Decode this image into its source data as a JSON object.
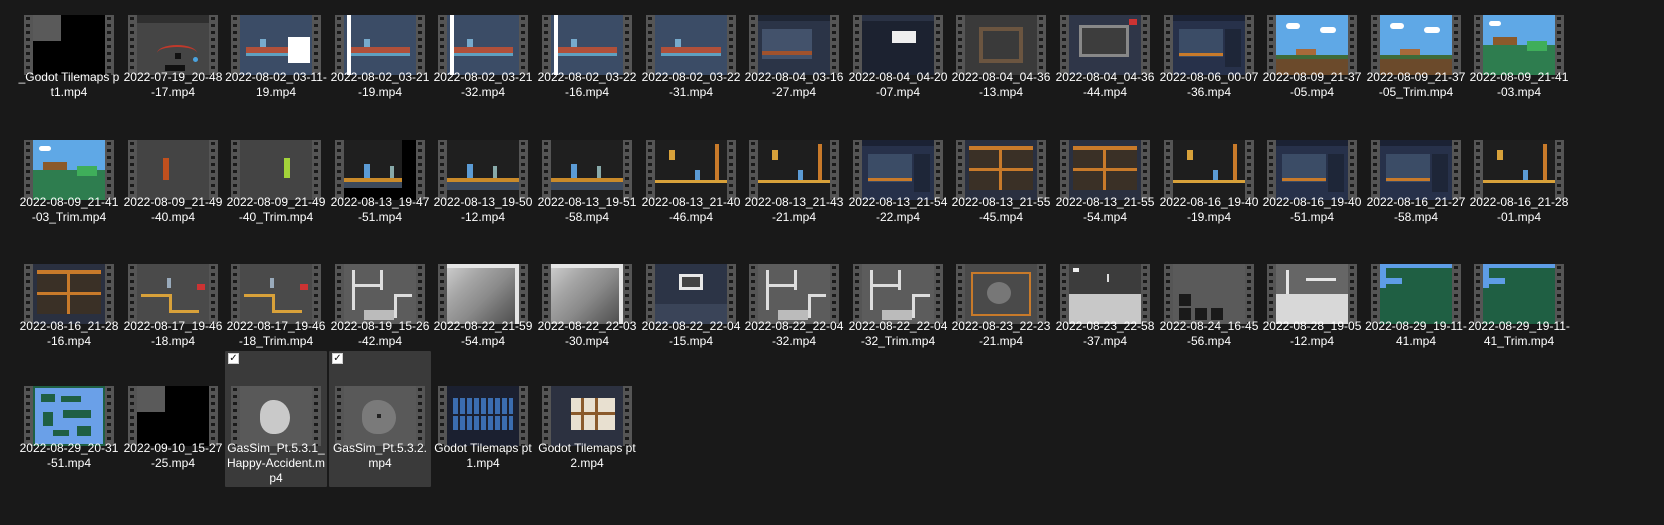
{
  "files": [
    {
      "row": 0,
      "col": 0,
      "name": "_Godot Tilemaps pt1.mp4",
      "thumb": "black-grey"
    },
    {
      "row": 0,
      "col": 1,
      "name": "2022-07-19_20-48-17.mp4",
      "thumb": "editor-red"
    },
    {
      "row": 0,
      "col": 2,
      "name": "2022-08-02_03-11-19.mp4",
      "thumb": "game-white"
    },
    {
      "row": 0,
      "col": 3,
      "name": "2022-08-02_03-21-19.mp4",
      "thumb": "game-bar"
    },
    {
      "row": 0,
      "col": 4,
      "name": "2022-08-02_03-21-32.mp4",
      "thumb": "game-bar"
    },
    {
      "row": 0,
      "col": 5,
      "name": "2022-08-02_03-22-16.mp4",
      "thumb": "game-bar"
    },
    {
      "row": 0,
      "col": 6,
      "name": "2022-08-02_03-22-31.mp4",
      "thumb": "game"
    },
    {
      "row": 0,
      "col": 7,
      "name": "2022-08-04_03-16-27.mp4",
      "thumb": "editor"
    },
    {
      "row": 0,
      "col": 8,
      "name": "2022-08-04_04-20-07.mp4",
      "thumb": "editor-dark"
    },
    {
      "row": 0,
      "col": 9,
      "name": "2022-08-04_04-36-13.mp4",
      "thumb": "room"
    },
    {
      "row": 0,
      "col": 10,
      "name": "2022-08-04_04-36-44.mp4",
      "thumb": "room-editor"
    },
    {
      "row": 0,
      "col": 11,
      "name": "2022-08-06_00-07-36.mp4",
      "thumb": "editor-blue"
    },
    {
      "row": 0,
      "col": 12,
      "name": "2022-08-09_21-37-05.mp4",
      "thumb": "sky"
    },
    {
      "row": 0,
      "col": 13,
      "name": "2022-08-09_21-37-05_Trim.mp4",
      "thumb": "sky"
    },
    {
      "row": 0,
      "col": 14,
      "name": "2022-08-09_21-41-03.mp4",
      "thumb": "sky-green"
    },
    {
      "row": 1,
      "col": 0,
      "name": "2022-08-09_21-41-03_Trim.mp4",
      "thumb": "sky-green"
    },
    {
      "row": 1,
      "col": 1,
      "name": "2022-08-09_21-49-40.mp4",
      "thumb": "grey-red"
    },
    {
      "row": 1,
      "col": 2,
      "name": "2022-08-09_21-49-40_Trim.mp4",
      "thumb": "grey-lime"
    },
    {
      "row": 1,
      "col": 3,
      "name": "2022-08-13_19-47-51.mp4",
      "thumb": "platform-black"
    },
    {
      "row": 1,
      "col": 4,
      "name": "2022-08-13_19-50-12.mp4",
      "thumb": "platform"
    },
    {
      "row": 1,
      "col": 5,
      "name": "2022-08-13_19-51-58.mp4",
      "thumb": "platform"
    },
    {
      "row": 1,
      "col": 6,
      "name": "2022-08-13_21-40-46.mp4",
      "thumb": "platform-orange"
    },
    {
      "row": 1,
      "col": 7,
      "name": "2022-08-13_21-43-21.mp4",
      "thumb": "platform-orange"
    },
    {
      "row": 1,
      "col": 8,
      "name": "2022-08-13_21-54-22.mp4",
      "thumb": "editor-blue"
    },
    {
      "row": 1,
      "col": 9,
      "name": "2022-08-13_21-55-45.mp4",
      "thumb": "rooms-orange"
    },
    {
      "row": 1,
      "col": 10,
      "name": "2022-08-13_21-55-54.mp4",
      "thumb": "rooms-orange"
    },
    {
      "row": 1,
      "col": 11,
      "name": "2022-08-16_19-40-19.mp4",
      "thumb": "platform-orange"
    },
    {
      "row": 1,
      "col": 12,
      "name": "2022-08-16_19-40-51.mp4",
      "thumb": "editor-blue"
    },
    {
      "row": 1,
      "col": 13,
      "name": "2022-08-16_21-27-58.mp4",
      "thumb": "editor-blue"
    },
    {
      "row": 1,
      "col": 14,
      "name": "2022-08-16_21-28-01.mp4",
      "thumb": "platform-orange"
    },
    {
      "row": 2,
      "col": 0,
      "name": "2022-08-16_21-28-16.mp4",
      "thumb": "rooms-orange"
    },
    {
      "row": 2,
      "col": 1,
      "name": "2022-08-17_19-46-18.mp4",
      "thumb": "pipes"
    },
    {
      "row": 2,
      "col": 2,
      "name": "2022-08-17_19-46-18_Trim.mp4",
      "thumb": "pipes"
    },
    {
      "row": 2,
      "col": 3,
      "name": "2022-08-19_15-26-42.mp4",
      "thumb": "maze-grey"
    },
    {
      "row": 2,
      "col": 4,
      "name": "2022-08-22_21-59-54.mp4",
      "thumb": "gradient"
    },
    {
      "row": 2,
      "col": 5,
      "name": "2022-08-22_22-03-30.mp4",
      "thumb": "gradient"
    },
    {
      "row": 2,
      "col": 6,
      "name": "2022-08-22_22-04-15.mp4",
      "thumb": "editor-maze"
    },
    {
      "row": 2,
      "col": 7,
      "name": "2022-08-22_22-04-32.mp4",
      "thumb": "maze-grey"
    },
    {
      "row": 2,
      "col": 8,
      "name": "2022-08-22_22-04-32_Trim.mp4",
      "thumb": "maze-grey"
    },
    {
      "row": 2,
      "col": 9,
      "name": "2022-08-23_22-23-21.mp4",
      "thumb": "gas-orange"
    },
    {
      "row": 2,
      "col": 10,
      "name": "2022-08-23_22-58-37.mp4",
      "thumb": "grey-floor"
    },
    {
      "row": 2,
      "col": 11,
      "name": "2022-08-24_16-45-56.mp4",
      "thumb": "dark-blocks"
    },
    {
      "row": 2,
      "col": 12,
      "name": "2022-08-28_19-05-12.mp4",
      "thumb": "maze-light"
    },
    {
      "row": 2,
      "col": 13,
      "name": "2022-08-29_19-11-41.mp4",
      "thumb": "green-blue"
    },
    {
      "row": 2,
      "col": 14,
      "name": "2022-08-29_19-11-41_Trim.mp4",
      "thumb": "green-blue"
    },
    {
      "row": 3,
      "col": 0,
      "name": "2022-08-29_20-31-51.mp4",
      "thumb": "blue-maze"
    },
    {
      "row": 3,
      "col": 1,
      "name": "2022-09-10_15-27-25.mp4",
      "thumb": "black-grey"
    },
    {
      "row": 3,
      "col": 2,
      "name": "GasSim_Pt.5.3.1_Happy-Accident.mp4",
      "thumb": "blob",
      "selected": true
    },
    {
      "row": 3,
      "col": 3,
      "name": "GasSim_Pt.5.3.2.mp4",
      "thumb": "blob-dark",
      "selected": true
    },
    {
      "row": 3,
      "col": 4,
      "name": "Godot Tilemaps pt1.mp4",
      "thumb": "icons"
    },
    {
      "row": 3,
      "col": 5,
      "name": "Godot Tilemaps pt2.mp4",
      "thumb": "tiles"
    }
  ],
  "checkbox_glyph": "✓"
}
